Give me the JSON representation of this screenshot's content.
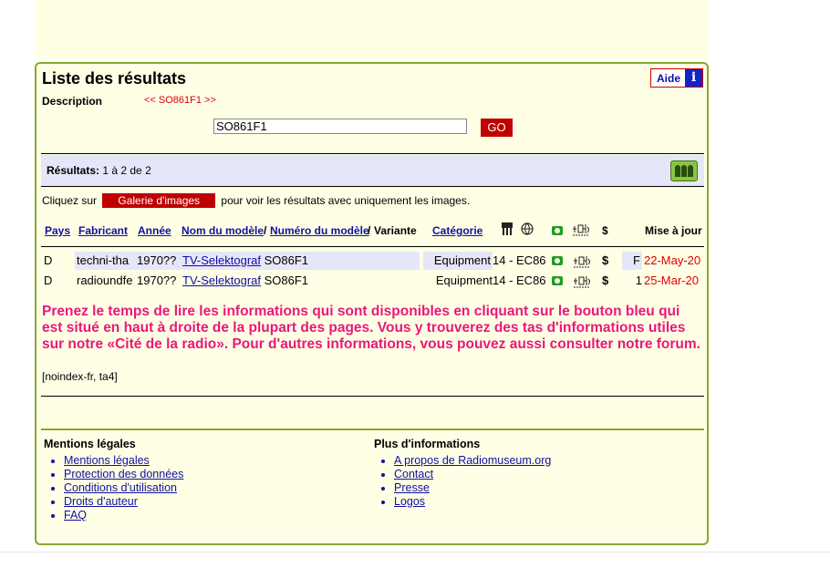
{
  "page": {
    "title": "Liste des résultats",
    "help_label": "Aide"
  },
  "description": {
    "label": "Description",
    "nav": "<< SO861F1 >>"
  },
  "search": {
    "value": "SO861F1",
    "button": "GO"
  },
  "results": {
    "label": "Résultats:",
    "range": "1 à 2 de 2"
  },
  "gallery": {
    "prefix": "Cliquez sur",
    "button": "Galerie d'images",
    "suffix": "pour voir les résultats avec uniquement les images."
  },
  "table": {
    "headers": {
      "pays": "Pays",
      "fabricant": "Fabricant",
      "annee": "Année",
      "nom": "Nom du modèle",
      "sep1": "/",
      "numero": "Numéro du modèle",
      "sep2": "/",
      "variante": "Variante",
      "categorie": "Catégorie",
      "dollar": "$",
      "mise": "Mise à jour"
    },
    "rows": [
      {
        "pays": "D",
        "fabricant": "techni-tha",
        "annee": "1970??",
        "nom": "TV-Selektograf",
        "numero": "SO86F1",
        "categorie": "Equipment",
        "tubes": "14 - EC86",
        "dollar": "$",
        "extra": "F",
        "date": "22-May-20"
      },
      {
        "pays": "D",
        "fabricant": "radioundfe",
        "annee": "1970??",
        "nom": "TV-Selektograf",
        "numero": "SO86F1",
        "categorie": "Equipment",
        "tubes": "14 - EC86",
        "dollar": "$",
        "extra": "1",
        "date": "25-Mar-20"
      }
    ]
  },
  "notice": "Prenez le temps de lire les informations qui sont disponibles en cliquant sur le bouton bleu qui est situé en haut à droite de la plupart des pages. Vous y trouverez des tas d'informations utiles sur notre «Cité de la radio». Pour d'autres informations, vous pouvez aussi consulter notre forum.",
  "noindex": "[noindex-fr, ta4]",
  "footer": {
    "legal": {
      "title": "Mentions légales",
      "items": [
        "Mentions légales",
        "Protection des données",
        "Conditions d'utilisation",
        "Droits d'auteur",
        "FAQ"
      ]
    },
    "more": {
      "title": "Plus d'informations",
      "items": [
        "A propos de Radiomuseum.org",
        "Contact",
        "Presse",
        "Logos"
      ]
    }
  },
  "colors": {
    "frame": "#86a72e",
    "accent_red": "#c00000",
    "pink": "#e8187a",
    "bg": "#ffffe6",
    "band": "#e6e6fa"
  }
}
